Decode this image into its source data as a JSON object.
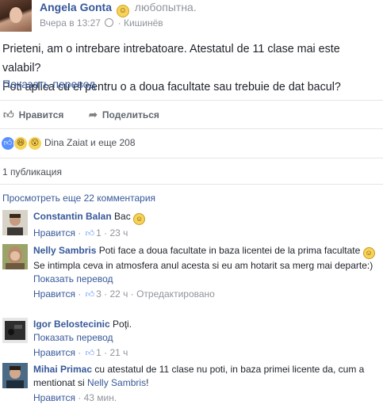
{
  "post": {
    "author": "Angela Gonta",
    "feeling": "любопытна.",
    "time": "Вчера в 13:27",
    "separator": "·",
    "location": "Кишинёв",
    "text_line1": "Prieteni, am o intrebare intrebatoare. Atestatul de 11 clase mai este valabil?",
    "text_line2": "Poti aplica cu el pentru o a doua facultate sau trebuie de dat bacul?",
    "translate": "Показать перевод"
  },
  "actions": {
    "like": "Нравится",
    "share": "Поделиться"
  },
  "reactions": {
    "summary": "Dina Zaiat и еще 208"
  },
  "shares": "1 публикация",
  "more_comments": "Просмотреть еще 22 комментария",
  "comment_actions": {
    "like": "Нравится",
    "translate": "Показать перевод"
  },
  "comments": [
    {
      "author": "Constantin Balan",
      "text": "Bac",
      "like_count": "1",
      "time": "23 ч"
    },
    {
      "author": "Nelly Sambris",
      "text_part1": "Poti face a doua facultate in baza licentei de la prima facultate",
      "text_part2": "Se intimpla ceva in atmosfera anul acesta si eu am hotarit sa merg mai departe:)",
      "like_count": "3",
      "time": "22 ч",
      "edited": "Отредактировано"
    },
    {
      "author": "Igor Belostecinic",
      "text": "Poţi.",
      "like_count": "1",
      "time": "21 ч"
    },
    {
      "author": "Mihai Primac",
      "text_part1": "cu atestatul de 11 clase nu poti, in baza primei licente da, cum a mentionat si",
      "mention": "Nelly Sambris",
      "text_part2": "!",
      "time": "43 мин."
    }
  ]
}
